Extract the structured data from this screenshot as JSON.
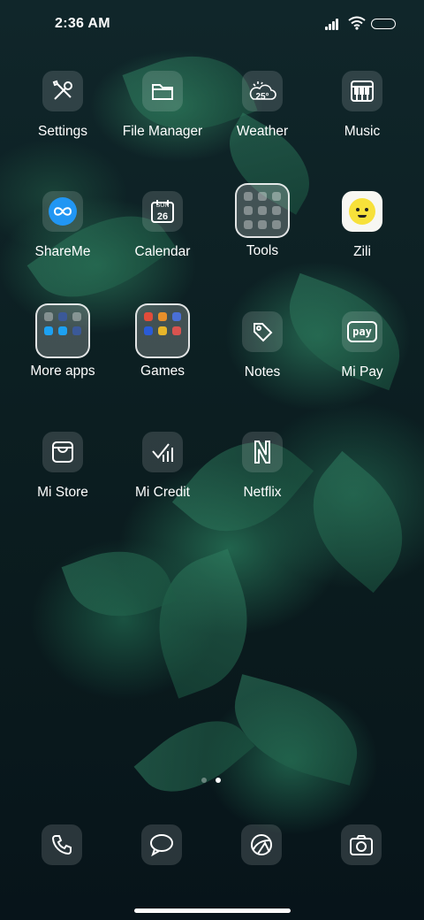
{
  "status_bar": {
    "time": "2:36 AM"
  },
  "apps": [
    {
      "label": "Settings",
      "icon": "tools-icon"
    },
    {
      "label": "File Manager",
      "icon": "folder-icon"
    },
    {
      "label": "Weather",
      "icon": "weather-icon",
      "temp": "25°"
    },
    {
      "label": "Music",
      "icon": "piano-icon"
    },
    {
      "label": "ShareMe",
      "icon": "infinity-icon"
    },
    {
      "label": "Calendar",
      "icon": "calendar-icon",
      "day": "SUN",
      "date": "26"
    },
    {
      "label": "Tools",
      "icon": "folder-grid-icon"
    },
    {
      "label": "Zili",
      "icon": "zili-face-icon"
    },
    {
      "label": "More apps",
      "icon": "folder-grid-icon"
    },
    {
      "label": "Games",
      "icon": "folder-grid-icon"
    },
    {
      "label": "Notes",
      "icon": "tag-icon"
    },
    {
      "label": "Mi Pay",
      "icon": "pay-icon",
      "badge": "pay"
    },
    {
      "label": "Mi Store",
      "icon": "store-bag-icon"
    },
    {
      "label": "Mi Credit",
      "icon": "credit-chart-icon"
    },
    {
      "label": "Netflix",
      "icon": "netflix-icon"
    }
  ],
  "page_indicator": {
    "pages": 2,
    "current": 2
  },
  "dock": [
    {
      "name": "phone",
      "icon": "phone-icon"
    },
    {
      "name": "messages",
      "icon": "message-bubble-icon"
    },
    {
      "name": "browser",
      "icon": "browser-icon"
    },
    {
      "name": "camera",
      "icon": "camera-icon"
    }
  ],
  "colors": {
    "accent_shareme": "#2196f3",
    "zili_yellow": "#f7e13a"
  }
}
